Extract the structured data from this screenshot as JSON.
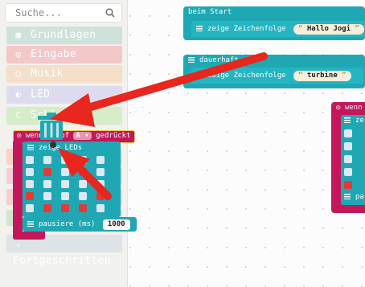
{
  "search": {
    "placeholder": "Suche..."
  },
  "categories": [
    {
      "label": "Grundlagen",
      "color": "#cfe2d9",
      "icon": "grid-icon"
    },
    {
      "label": "Eingabe",
      "color": "#f4c7c9",
      "icon": "target-icon"
    },
    {
      "label": "Musik",
      "color": "#f4dfc9",
      "icon": "headphones-icon"
    },
    {
      "label": "LED",
      "color": "#dcdcee",
      "icon": "toggle-icon"
    },
    {
      "label": "Schleifen",
      "color": "#d4edc8",
      "icon": "loop-icon"
    },
    {
      "label": "Fortgeschritten",
      "color": "#dde3e6",
      "icon": "chevron-down-icon"
    }
  ],
  "blocks": {
    "on_start": {
      "label": "beim Start",
      "show_string": "zeige Zeichenfolge",
      "value": "Hallo Jogi"
    },
    "forever": {
      "label": "dauerhaft",
      "show_string": "zeige Zeichenfolge",
      "value": "turbine"
    },
    "on_button": {
      "label": "wenn Knopf",
      "button": "A",
      "suffix": "gedrückt",
      "show_leds": "zeige LEDs",
      "pause": "pausiere (ms)",
      "pause_value": "1000"
    },
    "right_event": {
      "label": "wenn",
      "show_fragment": "ze",
      "pause_fragment": "pa"
    }
  },
  "led_matrix": [
    [
      0,
      0,
      0,
      0,
      0
    ],
    [
      0,
      1,
      0,
      1,
      0
    ],
    [
      0,
      0,
      0,
      0,
      0
    ],
    [
      1,
      0,
      0,
      0,
      1
    ],
    [
      0,
      1,
      1,
      1,
      0
    ]
  ],
  "colors": {
    "basic_block": "#1fa8b4",
    "event_block": "#c2185b",
    "led_off": "#dde8f3",
    "led_on": "#e53935",
    "arrow": "#e8261c"
  }
}
